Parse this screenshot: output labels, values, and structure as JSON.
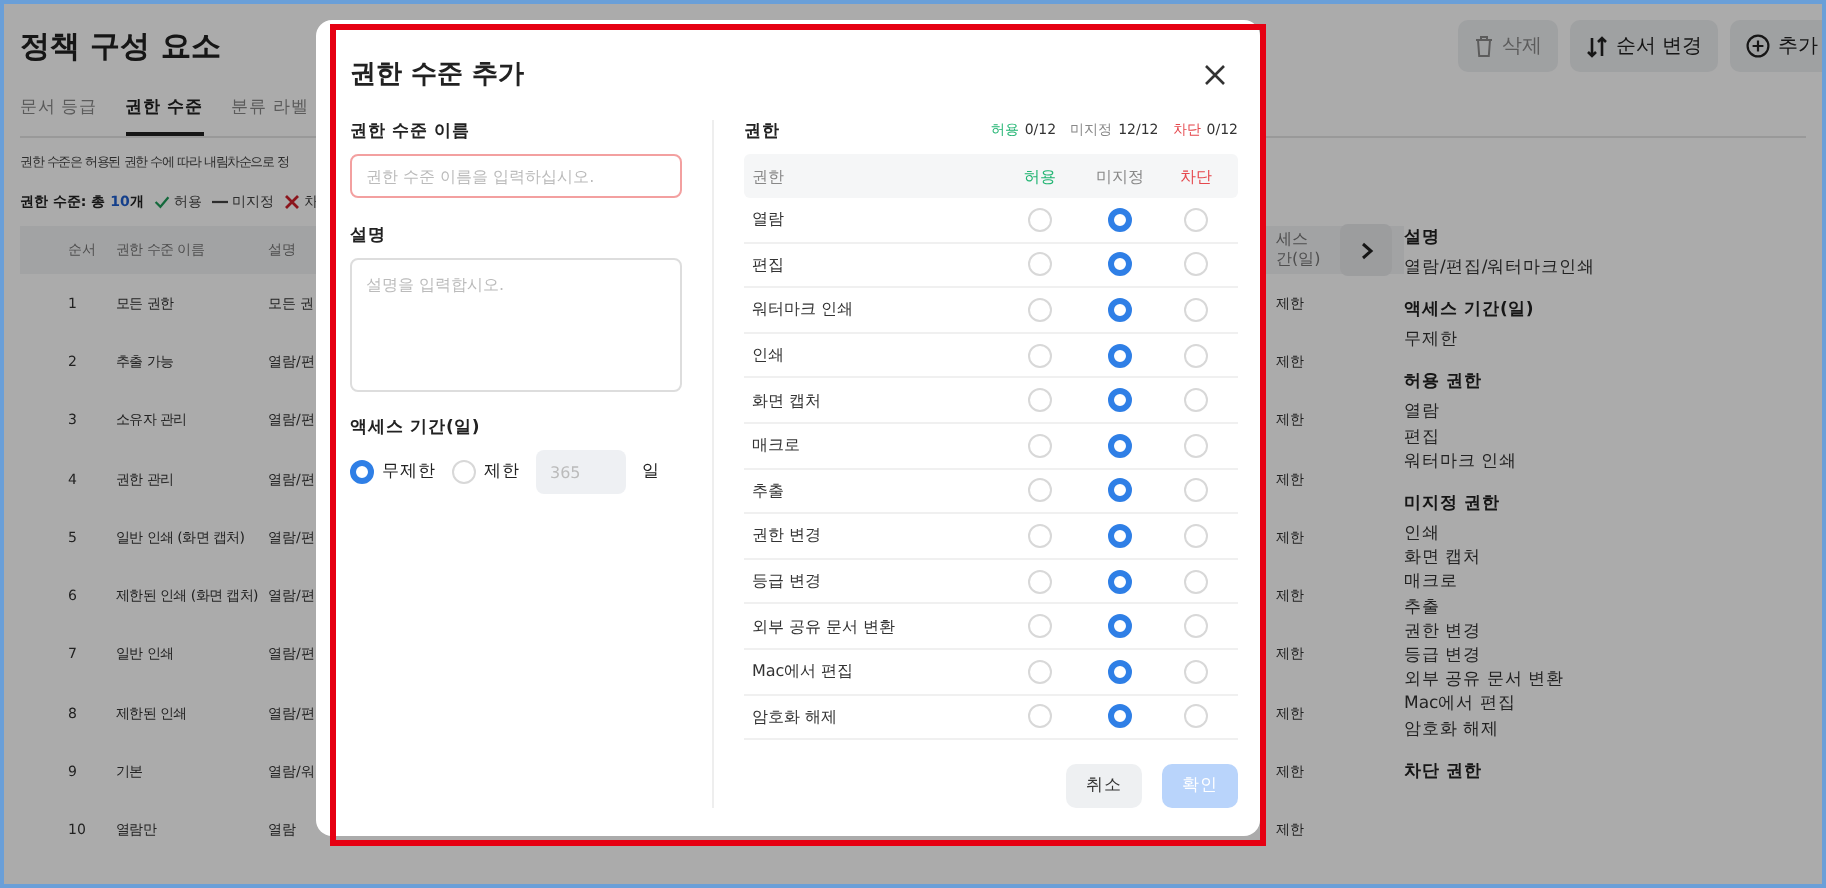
{
  "page": {
    "title": "정책 구성 요소",
    "toolbar": [
      {
        "kind": "trash",
        "label": "삭제",
        "disabled": true
      },
      {
        "kind": "sort",
        "label": "순서 변경",
        "disabled": false
      },
      {
        "kind": "plus",
        "label": "추가",
        "disabled": false
      }
    ],
    "tabs": [
      {
        "label": "문서 등급",
        "selected": false
      },
      {
        "label": "권한 수준",
        "selected": true
      },
      {
        "label": "분류 라벨",
        "selected": false
      }
    ],
    "description": "권한 수준은 허용된 권한 수에 따라 내림차순으로 정",
    "summary": {
      "prefix": "권한 수준: 총",
      "count": "10",
      "suffix": "개"
    },
    "legend": [
      {
        "kind": "allow",
        "label": "허용"
      },
      {
        "kind": "unspecified",
        "label": "미지정"
      },
      {
        "kind": "block",
        "label": "차"
      }
    ],
    "table": {
      "columns": [
        "순서",
        "권한 수준 이름",
        "설명"
      ],
      "access_column": "세스 간(일)",
      "rows": [
        {
          "order": "1",
          "name": "모든 권한",
          "description": "모든 권",
          "access": "제한"
        },
        {
          "order": "2",
          "name": "추출 가능",
          "description": "열람/편",
          "access": "제한"
        },
        {
          "order": "3",
          "name": "소유자 관리",
          "description": "열람/편",
          "access": "제한"
        },
        {
          "order": "4",
          "name": "권한 관리",
          "description": "열람/편",
          "access": "제한"
        },
        {
          "order": "5",
          "name": "일반 인쇄 (화면 캡처)",
          "description": "열람/편",
          "access": "제한"
        },
        {
          "order": "6",
          "name": "제한된 인쇄 (화면 캡처)",
          "description": "열람/편",
          "access": "제한"
        },
        {
          "order": "7",
          "name": "일반 인쇄",
          "description": "열람/편",
          "access": "제한"
        },
        {
          "order": "8",
          "name": "제한된 인쇄",
          "description": "열람/편",
          "access": "제한"
        },
        {
          "order": "9",
          "name": "기본",
          "description": "열람/워",
          "access": "제한"
        },
        {
          "order": "10",
          "name": "열람만",
          "description": "열람",
          "access": "제한"
        }
      ]
    },
    "detail": [
      {
        "title": "설명",
        "items": [
          "열람/편집/워터마크인쇄"
        ]
      },
      {
        "title": "액세스 기간(일)",
        "items": [
          "무제한"
        ]
      },
      {
        "title": "허용 권한",
        "items": [
          "열람",
          "편집",
          "워터마크 인쇄"
        ]
      },
      {
        "title": "미지정 권한",
        "items": [
          "인쇄",
          "화면 캡처",
          "매크로",
          "추출",
          "권한 변경",
          "등급 변경",
          "외부 공유 문서 변환",
          "Mac에서 편집",
          "암호화 해제"
        ]
      },
      {
        "title": "차단 권한"
      }
    ]
  },
  "modal": {
    "title": "권한 수준 추가",
    "name_field": {
      "label": "권한 수준 이름",
      "placeholder": "권한 수준 이름을 입력하십시오.",
      "invalid": true
    },
    "description_field": {
      "label": "설명",
      "placeholder": "설명을 입력합시오."
    },
    "access": {
      "label": "액세스 기간(일)",
      "options": [
        {
          "label": "무제한",
          "selected": true
        },
        {
          "label": "제한",
          "selected": false
        }
      ],
      "days_placeholder": "365",
      "days_disabled": true,
      "unit": "일"
    },
    "permissions": {
      "label": "권한",
      "counts": [
        {
          "kind": "allow",
          "label": "허용",
          "value": "0/12"
        },
        {
          "kind": "unspecified",
          "label": "미지정",
          "value": "12/12"
        },
        {
          "kind": "block",
          "label": "차단",
          "value": "0/12"
        }
      ],
      "columns": [
        {
          "kind": "name",
          "label": "권한"
        },
        {
          "kind": "allow",
          "label": "허용"
        },
        {
          "kind": "unspecified",
          "label": "미지정"
        },
        {
          "kind": "block",
          "label": "차단"
        }
      ],
      "rows": [
        {
          "name": "열람",
          "allow": false,
          "unspecified": true,
          "block": false
        },
        {
          "name": "편집",
          "allow": false,
          "unspecified": true,
          "block": false
        },
        {
          "name": "워터마크 인쇄",
          "allow": false,
          "unspecified": true,
          "block": false
        },
        {
          "name": "인쇄",
          "allow": false,
          "unspecified": true,
          "block": false
        },
        {
          "name": "화면 캡처",
          "allow": false,
          "unspecified": true,
          "block": false
        },
        {
          "name": "매크로",
          "allow": false,
          "unspecified": true,
          "block": false
        },
        {
          "name": "추출",
          "allow": false,
          "unspecified": true,
          "block": false
        },
        {
          "name": "권한 변경",
          "allow": false,
          "unspecified": true,
          "block": false
        },
        {
          "name": "등급 변경",
          "allow": false,
          "unspecified": true,
          "block": false
        },
        {
          "name": "외부 공유 문서 변환",
          "allow": false,
          "unspecified": true,
          "block": false
        },
        {
          "name": "Mac에서 편집",
          "allow": false,
          "unspecified": true,
          "block": false
        },
        {
          "name": "암호화 해제",
          "allow": false,
          "unspecified": true,
          "block": false
        }
      ]
    },
    "buttons": [
      {
        "kind": "cancel",
        "label": "취소",
        "disabled": false
      },
      {
        "kind": "confirm",
        "label": "확인",
        "disabled": true
      }
    ]
  },
  "highlight": {
    "shown": true
  }
}
